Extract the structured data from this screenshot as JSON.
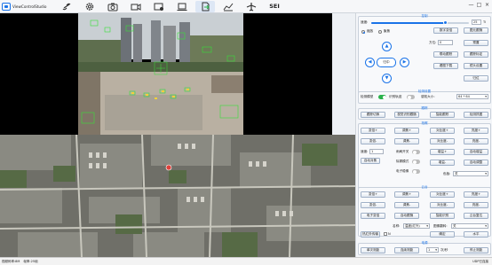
{
  "app": {
    "title": "ViewControlStudio"
  },
  "toolbar": {
    "sei_label": "SEI",
    "icons": [
      "link-icon",
      "settings-icon",
      "camera-icon",
      "video-icon",
      "map-settings-icon",
      "laptop-icon",
      "file-export-icon",
      "chart-icon",
      "airplane-icon"
    ],
    "active": "file-export-icon"
  },
  "window": {
    "min": "—",
    "max": "□",
    "close": "×"
  },
  "colors": {
    "accent": "#1a73e8",
    "toggle_on": "#2bb24c"
  },
  "panel": {
    "control": {
      "title": "控制",
      "speed_label": "速度:",
      "speed_value": "25",
      "speed_unit": "Ti",
      "speed_fraction": 0.76,
      "mode_a": "缩放",
      "mode_b": "聚焦",
      "mode_selected": "缩放",
      "btn_zoom_in": "数字变倍",
      "btn_zoom_out": "图元跟随",
      "preset_label": "方位:",
      "preset_value": "0",
      "btn_preset_go": "预置",
      "btn_auto": "自动扫描",
      "btn_a1": "联动跟踪",
      "btn_a2": "跟踪标定",
      "btn_a3": "看图下载",
      "btn_a4": "镜头设置",
      "btn_return": "归位",
      "center_label": "归中"
    },
    "detect": {
      "title": "检测设置",
      "enable_label": "检测模型",
      "enable_on": true,
      "feed_label": "识别轨迹",
      "feed_on": false,
      "size_label": "感知大小:",
      "size_value": "64 * 64"
    },
    "track": {
      "title": "跟踪",
      "btn1": "跟踪切换",
      "btn2": "视觉识别跟随",
      "btn3": "智能跟踪",
      "btn4": "检测抓图"
    },
    "photo": {
      "title": "拍照",
      "r1": [
        "变倍+",
        "调焦+",
        "对比度+",
        "亮度+"
      ],
      "r2": [
        "变倍-",
        "调焦-",
        "对比度-",
        "亮度-"
      ],
      "rate_label": "速度:",
      "rate_value": "1",
      "wiper_label": "雨刷开关",
      "wiper_on": false,
      "heat_label": "除雾模式",
      "heat_on": false,
      "ir_label": "电子稳像",
      "ir_on": false,
      "btn_rec": "自动对焦",
      "b_side1": "增益+",
      "b_side2": "自动增益",
      "b_side3": "增益-",
      "b_side4": "自动调整",
      "pal_label": "色板:",
      "pal_value": "关"
    },
    "ptz": {
      "title": "云台",
      "r1": [
        "变倍+",
        "调焦+",
        "对比度+",
        "亮度+"
      ],
      "r2": [
        "变倍-",
        "调焦-",
        "对比度-",
        "亮度-"
      ],
      "r3": [
        "电子变倍",
        "自动跟随",
        "智能识别",
        "云台复位"
      ],
      "name_label": "名称:",
      "name_value": "温度(红外)",
      "mode_label": "图像翻转:",
      "mode_value": "关",
      "btn_tc": "热红外传输",
      "btn_n": "N",
      "btn_ok": "确定",
      "btn_vert": "水平"
    },
    "power": {
      "title": "电源",
      "btn1": "单次测距",
      "btn2": "连续测距",
      "btn3": "停止测距",
      "val_label": "次/秒",
      "val": "1"
    }
  },
  "status": {
    "left1": "视频码率:8M",
    "left2": "帧率:25帧",
    "right": "UDP已连接"
  },
  "video": {
    "overlay": "1.0x"
  }
}
